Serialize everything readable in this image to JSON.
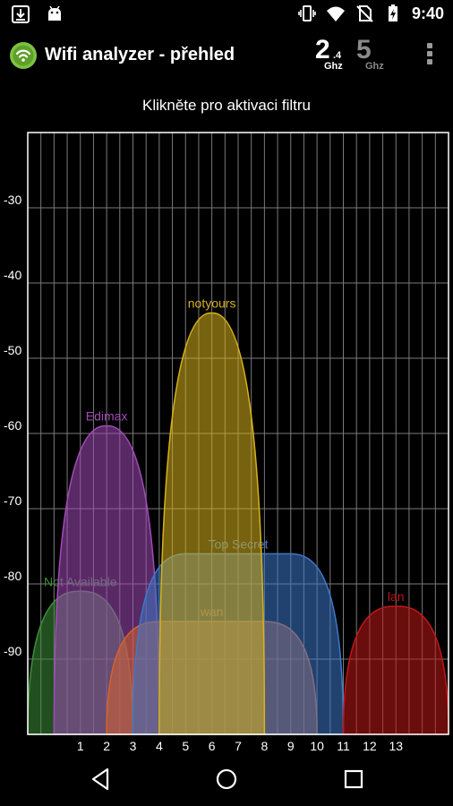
{
  "status_bar": {
    "time": "9:40",
    "left_icons": [
      "download-icon",
      "android-icon"
    ],
    "right_icons": [
      "vibrate-icon",
      "wifi-icon",
      "no-sim-icon",
      "battery-charging-icon"
    ]
  },
  "app_bar": {
    "title": "Wifi analyzer - přehled",
    "logo_icon": "wifi-analyzer-logo-icon",
    "band_24": {
      "num": "2",
      "sub": ".4",
      "unit": "Ghz"
    },
    "band_5": {
      "num": "5",
      "unit": "Ghz"
    },
    "menu_icon": "overflow-menu-icon"
  },
  "filter_hint": "Klikněte pro aktivaci filtru",
  "colors": {
    "accent_green": "#7cc242",
    "active_band": "#ffffff",
    "inactive_band": "#8a8a8a",
    "grid": "#7a7a7a"
  },
  "chart_data": {
    "type": "area",
    "x_ticks": [
      1,
      2,
      3,
      4,
      5,
      6,
      7,
      8,
      9,
      10,
      11,
      12,
      13
    ],
    "xlim": [
      -1,
      15
    ],
    "ylim": [
      -100,
      -20
    ],
    "y_ticks": [
      -30,
      -40,
      -50,
      -60,
      -70,
      -80,
      -90
    ],
    "grid": true,
    "series": [
      {
        "name": "Not Available",
        "channel_from": -1,
        "channel_to": 3,
        "peak": -81,
        "color": "#3d8f3a",
        "shape": "arch"
      },
      {
        "name": "Edimax",
        "channel_from": 0,
        "channel_to": 4,
        "peak": -59,
        "color": "#a24ab8",
        "shape": "arch"
      },
      {
        "name": "wan",
        "channel_from": 2,
        "channel_to": 10,
        "peak": -85,
        "color": "#d9622a",
        "shape": "flat"
      },
      {
        "name": "Top Secret",
        "channel_from": 3,
        "channel_to": 11,
        "peak": -76,
        "color": "#3d78c8",
        "shape": "flat"
      },
      {
        "name": "notyours",
        "channel_from": 4,
        "channel_to": 8,
        "peak": -44,
        "color": "#d7b21c",
        "shape": "arch"
      },
      {
        "name": "lan",
        "channel_from": 11,
        "channel_to": 15,
        "peak": -83,
        "color": "#c01818",
        "shape": "arch"
      }
    ]
  },
  "nav_bar": {
    "back_icon": "back-icon",
    "home_icon": "home-icon",
    "recent_icon": "recent-apps-icon"
  }
}
